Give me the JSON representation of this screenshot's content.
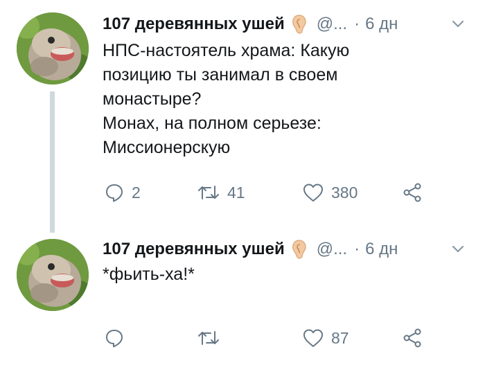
{
  "tweets": [
    {
      "author": {
        "name": "107 деревянных ушей",
        "handle": "@...",
        "time": "6 дн"
      },
      "text_lines": [
        "НПС-настоятель храма: Какую",
        "позицию ты занимал в своем",
        "монастыре?",
        "Монах, на полном серьезе:",
        "Миссионерскую"
      ],
      "reply_count": "2",
      "retweet_count": "41",
      "like_count": "380"
    },
    {
      "author": {
        "name": "107 деревянных ушей",
        "handle": "@...",
        "time": "6 дн"
      },
      "text_lines": [
        "*фьить-ха!*"
      ],
      "reply_count": "",
      "retweet_count": "",
      "like_count": "87"
    }
  ],
  "separator": "·",
  "icons": {
    "reply": "reply-icon",
    "retweet": "retweet-icon",
    "like": "heart-icon",
    "share": "share-icon",
    "menu": "chevron-down-icon",
    "name_emoji": "ear-emoji-icon"
  },
  "colors": {
    "text": "#14171a",
    "secondary": "#657786",
    "thread_line": "#cfd9de"
  }
}
